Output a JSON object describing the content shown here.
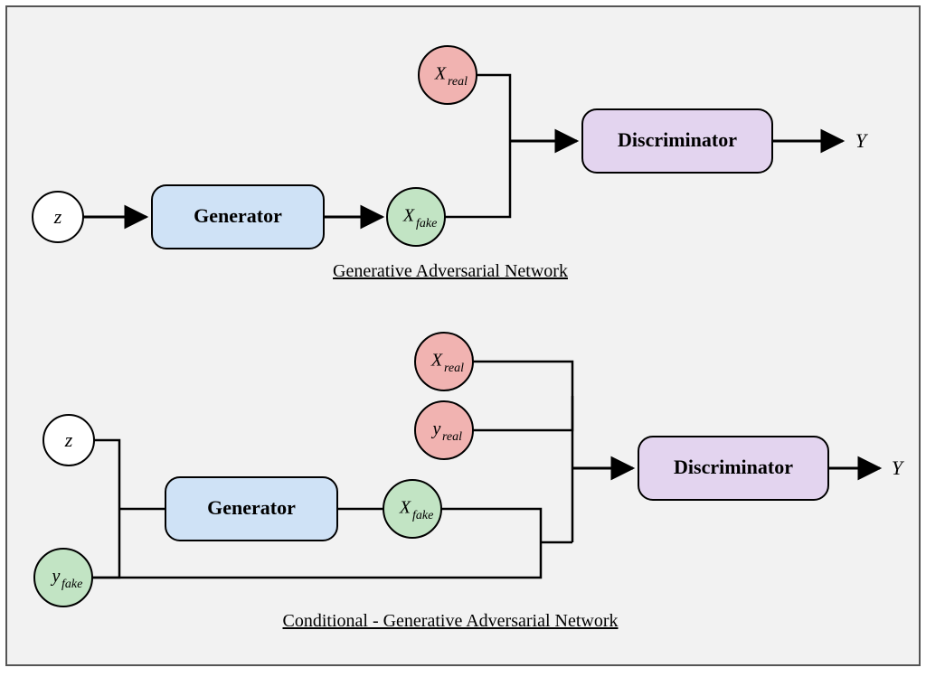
{
  "colors": {
    "generator": "#cfe2f6",
    "discriminator": "#e3d4ef",
    "real": "#f1b3b1",
    "fake": "#c2e4c4",
    "input": "#ffffff"
  },
  "top": {
    "caption": "Generative Adversarial Network",
    "nodes": {
      "z": "z",
      "generator": "Generator",
      "x_real": {
        "base": "X",
        "sub": "real"
      },
      "x_fake": {
        "base": "X",
        "sub": "fake"
      },
      "discriminator": "Discriminator",
      "y": "Y"
    }
  },
  "bottom": {
    "caption": "Conditional - Generative Adversarial Network",
    "nodes": {
      "z": "z",
      "y_fake": {
        "base": "y",
        "sub": "fake"
      },
      "generator": "Generator",
      "x_real": {
        "base": "X",
        "sub": "real"
      },
      "y_real": {
        "base": "y",
        "sub": "real"
      },
      "x_fake": {
        "base": "X",
        "sub": "fake"
      },
      "discriminator": "Discriminator",
      "y": "Y"
    }
  }
}
